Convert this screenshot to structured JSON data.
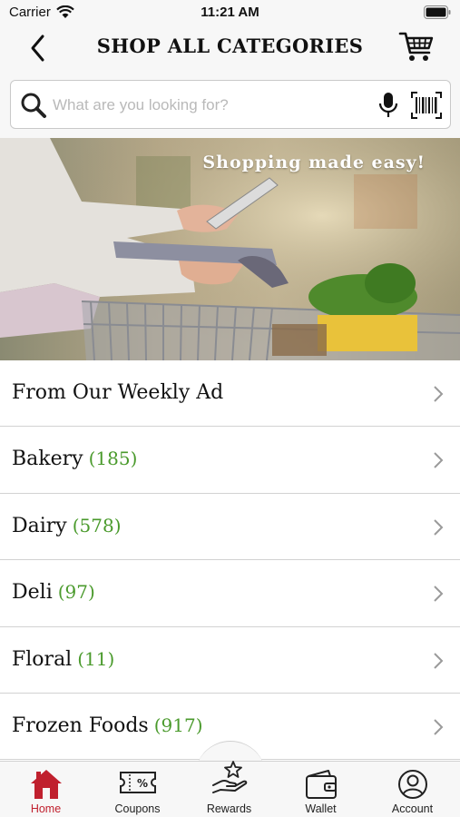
{
  "status_bar": {
    "carrier": "Carrier",
    "time": "11:21 AM"
  },
  "header": {
    "title": "SHOP ALL CATEGORIES",
    "back_icon": "chevron-left-icon",
    "cart_icon": "cart-icon"
  },
  "search": {
    "placeholder": "What are you looking for?",
    "value": ""
  },
  "banner": {
    "caption": "Shopping made easy!"
  },
  "categories": [
    {
      "name": "From Our Weekly Ad",
      "count": ""
    },
    {
      "name": "Bakery",
      "count": "(185)"
    },
    {
      "name": "Dairy",
      "count": "(578)"
    },
    {
      "name": "Deli",
      "count": "(97)"
    },
    {
      "name": "Floral",
      "count": "(11)"
    },
    {
      "name": "Frozen Foods",
      "count": "(917)"
    }
  ],
  "tabs": [
    {
      "label": "Home",
      "icon": "home-icon",
      "active": true
    },
    {
      "label": "Coupons",
      "icon": "coupon-icon",
      "active": false
    },
    {
      "label": "Rewards",
      "icon": "rewards-icon",
      "active": false
    },
    {
      "label": "Wallet",
      "icon": "wallet-icon",
      "active": false
    },
    {
      "label": "Account",
      "icon": "account-icon",
      "active": false
    }
  ],
  "colors": {
    "accent": "#c0202e",
    "count_green": "#4a9a2c",
    "bar_bg": "#f7f7f7"
  }
}
